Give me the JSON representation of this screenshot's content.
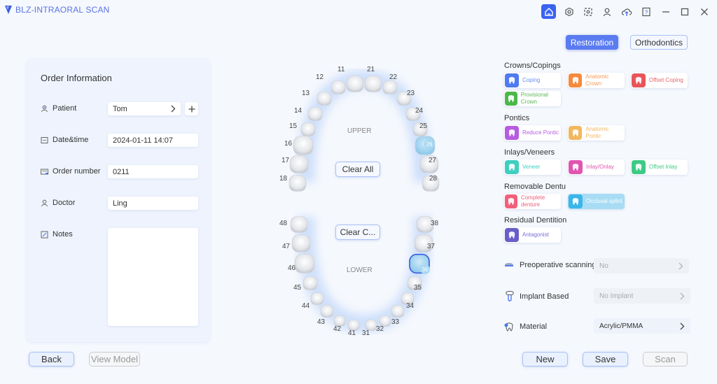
{
  "app": {
    "title": "BLZ-INTRAORAL SCAN"
  },
  "toolbar": {
    "icons": [
      "home-icon",
      "settings-icon",
      "scan-frame-icon",
      "user-icon",
      "cloud-upload-icon",
      "help-icon"
    ],
    "window": [
      "minimize-icon",
      "maximize-icon",
      "close-icon"
    ]
  },
  "order": {
    "title": "Order Information",
    "patient": {
      "label": "Patient",
      "value": "Tom"
    },
    "datetime": {
      "label": "Date&time",
      "value": "2024-01-11 14:07"
    },
    "order_number": {
      "label": "Order number",
      "value": "0211"
    },
    "doctor": {
      "label": "Doctor",
      "value": "Ling"
    },
    "notes": {
      "label": "Notes",
      "value": ""
    }
  },
  "bottom_left": {
    "back": "Back",
    "view_model": "View Model"
  },
  "bottom_right": {
    "new": "New",
    "save": "Save",
    "scan": "Scan"
  },
  "teeth": {
    "upper_label": "UPPER",
    "lower_label": "LOWER",
    "clear_upper": "Clear All",
    "clear_lower": "Clear C...",
    "upper": [
      "18",
      "17",
      "16",
      "15",
      "14",
      "13",
      "12",
      "11",
      "21",
      "22",
      "23",
      "24",
      "25",
      "26",
      "27",
      "28"
    ],
    "lower": [
      "48",
      "47",
      "46",
      "45",
      "44",
      "43",
      "42",
      "41",
      "31",
      "32",
      "33",
      "34",
      "35",
      "36",
      "37",
      "38"
    ],
    "selected_upper": "26",
    "selected_lower": "36"
  },
  "mode_tabs": {
    "restoration": "Restoration",
    "orthodontics": "Orthodontics",
    "active": "Restoration"
  },
  "sections": [
    {
      "title": "Crowns/Copings",
      "items": [
        {
          "label": "Coping",
          "color": "#4f7af0",
          "text_color": "#6b8af0"
        },
        {
          "label": "Anatomic Crown",
          "color": "#f58a3c",
          "text_color": "#f59a5a"
        },
        {
          "label": "Offset Coping",
          "color": "#e8555a",
          "text_color": "#e8656a"
        },
        {
          "label": "Provisional Crown",
          "color": "#4cb84a",
          "text_color": "#5cb85a"
        }
      ]
    },
    {
      "title": "Pontics",
      "items": [
        {
          "label": "Reduce Pontic",
          "color": "#b65ce0",
          "text_color": "#b65ce0"
        },
        {
          "label": "Anatomic Pontic",
          "color": "#f2b760",
          "text_color": "#f2b760"
        }
      ]
    },
    {
      "title": "Inlays/Veneers",
      "items": [
        {
          "label": "Veneer",
          "color": "#3fcfc0",
          "text_color": "#3fcfc0"
        },
        {
          "label": "Inlay/Onlay",
          "color": "#e055b0",
          "text_color": "#e055b0"
        },
        {
          "label": "Offset Inlay",
          "color": "#3dca85",
          "text_color": "#3dca85"
        }
      ]
    },
    {
      "title": "Removable Dentu",
      "items": [
        {
          "label": "Complete denture",
          "color": "#f0607a",
          "text_color": "#f0607a"
        },
        {
          "label": "Occlusal splint",
          "color": "#3ab6e8",
          "text_color": "#ffffff",
          "selected": true
        }
      ]
    },
    {
      "title": "Residual Dentition",
      "items": [
        {
          "label": "Antagonist",
          "color": "#6a5ec8",
          "text_color": "#7a6ed8"
        }
      ]
    }
  ],
  "options": {
    "preoperative": {
      "label": "Preoperative scanning",
      "value": "No"
    },
    "implant": {
      "label": "Implant Based",
      "value": "No Implant"
    },
    "material": {
      "label": "Material",
      "value": "Acrylic/PMMA"
    }
  }
}
